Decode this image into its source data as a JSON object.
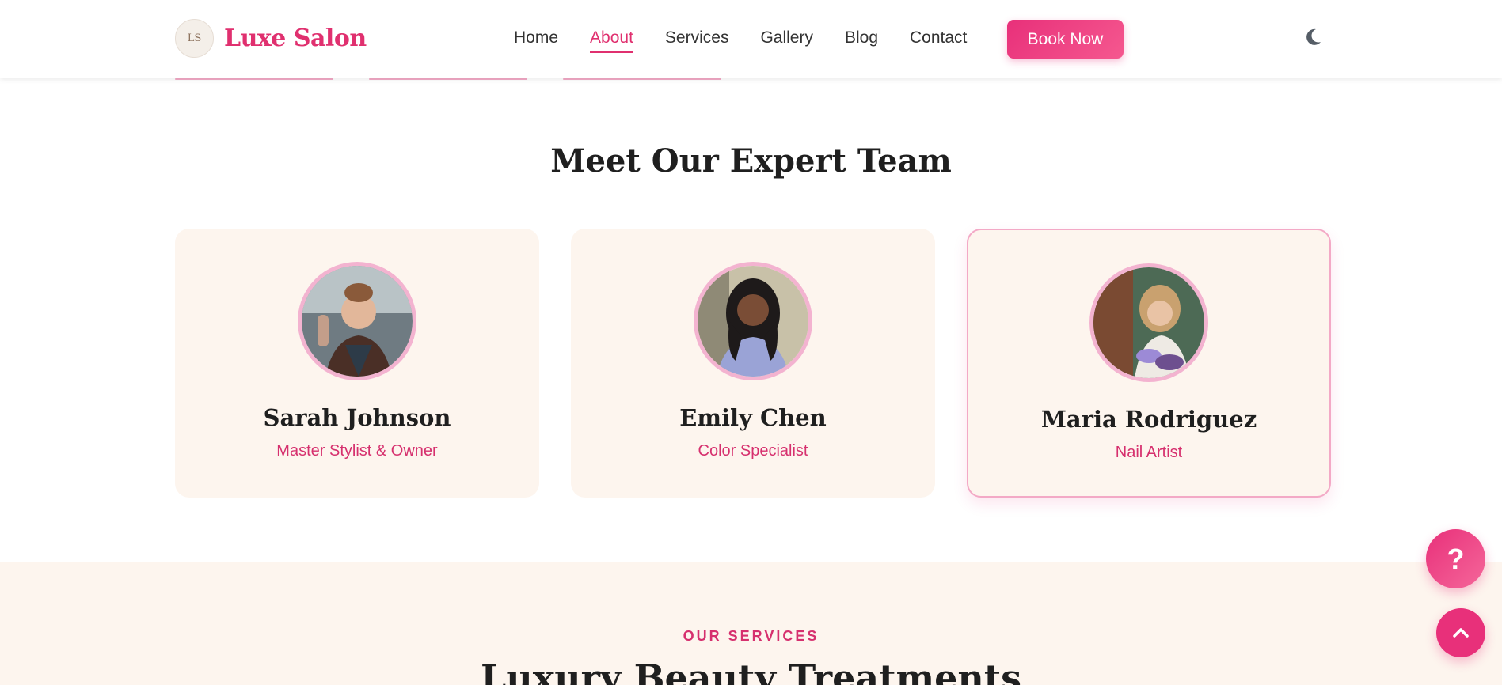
{
  "brand": {
    "logo_text": "Luxe Salon",
    "logo_badge": "LS",
    "accent": "#e0306f"
  },
  "nav": {
    "items": [
      {
        "label": "Home",
        "active": false
      },
      {
        "label": "About",
        "active": true
      },
      {
        "label": "Services",
        "active": false
      },
      {
        "label": "Gallery",
        "active": false
      },
      {
        "label": "Blog",
        "active": false
      },
      {
        "label": "Contact",
        "active": false
      }
    ],
    "cta_label": "Book Now",
    "theme_icon": "moon-icon"
  },
  "team": {
    "title": "Meet Our Expert Team",
    "members": [
      {
        "name": "Sarah Johnson",
        "role": "Master Stylist & Owner"
      },
      {
        "name": "Emily Chen",
        "role": "Color Specialist"
      },
      {
        "name": "Maria Rodriguez",
        "role": "Nail Artist"
      }
    ]
  },
  "services": {
    "kicker": "OUR SERVICES",
    "title": "Luxury Beauty Treatments"
  },
  "floating": {
    "help_label": "?",
    "help_icon": "question-icon",
    "top_icon": "chevron-up-icon"
  }
}
